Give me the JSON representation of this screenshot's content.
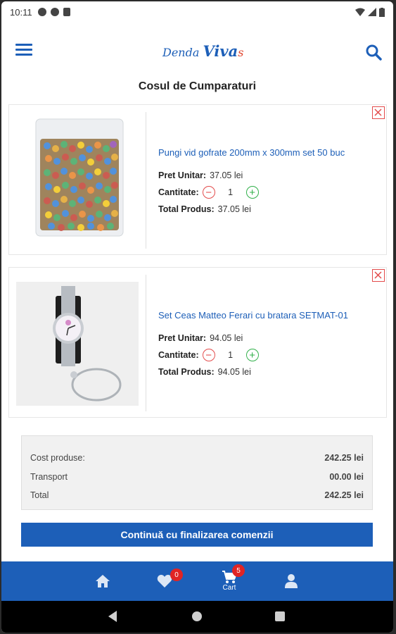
{
  "status_bar": {
    "time": "10:11"
  },
  "app_bar": {
    "logo": {
      "part1": "Denda ",
      "part2": "Viva",
      "part3": "s"
    },
    "menu_icon": "hamburger-menu-icon",
    "search_icon": "search-icon"
  },
  "page": {
    "title": "Cosul de Cumparaturi"
  },
  "cart": {
    "items": [
      {
        "name": "Pungi vid gofrate 200mm x 300mm set 50 buc",
        "unit_price_label": "Pret Unitar:",
        "unit_price": "37.05 lei",
        "quantity_label": "Cantitate:",
        "quantity": "1",
        "total_label": "Total Produs:",
        "total": "37.05 lei"
      },
      {
        "name": "Set Ceas Matteo Ferari cu bratara SETMAT-01",
        "unit_price_label": "Pret Unitar:",
        "unit_price": "94.05 lei",
        "quantity_label": "Cantitate:",
        "quantity": "1",
        "total_label": "Total Produs:",
        "total": "94.05 lei"
      }
    ]
  },
  "summary": {
    "products_cost_label": "Cost produse:",
    "products_cost": "242.25 lei",
    "transport_label": "Transport",
    "transport": "00.00 lei",
    "total_label": "Total",
    "total": "242.25 lei"
  },
  "checkout_button": "Continuă cu finalizarea comenzii",
  "bottom_nav": {
    "home_icon": "home-icon",
    "favorites_icon": "heart-icon",
    "favorites_badge": "0",
    "cart_icon": "cart-icon",
    "cart_label": "Cart",
    "cart_badge": "5",
    "account_icon": "user-icon"
  },
  "colors": {
    "brand_blue": "#1d5fb8",
    "remove_red": "#e34b4b",
    "add_green": "#31b04a",
    "badge_red": "#e02424"
  }
}
